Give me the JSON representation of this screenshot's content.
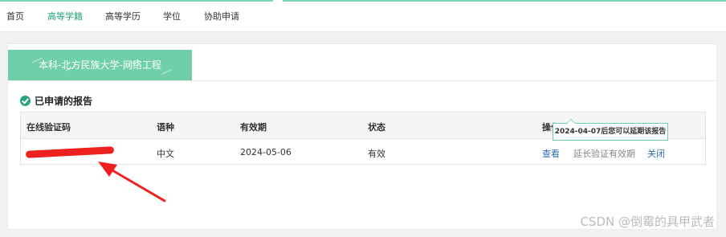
{
  "nav": {
    "items": [
      {
        "label": "首页",
        "active": false
      },
      {
        "label": "高等学籍",
        "active": true
      },
      {
        "label": "高等学历",
        "active": false
      },
      {
        "label": "学位",
        "active": false
      },
      {
        "label": "协助申请",
        "active": false
      }
    ]
  },
  "tab": {
    "label": "本科-北方民族大学-网络工程"
  },
  "section": {
    "title": "已申请的报告",
    "icon": "check-circle-icon"
  },
  "table": {
    "headers": [
      "在线验证码",
      "语种",
      "有效期",
      "状态",
      "操作"
    ],
    "rows": [
      {
        "code": "",
        "language": "中文",
        "expiry": "2024-05-06",
        "status": "有效",
        "actions": {
          "view": "查看",
          "extend": "延长验证有效期",
          "close": "关闭"
        }
      }
    ]
  },
  "tooltip": {
    "text": "2024-04-07后您可以延期该报告"
  },
  "watermark": {
    "text": "CSDN @倒霉的具甲武者"
  },
  "colors": {
    "accent": "#27a47a",
    "banner": "#6fcfa9",
    "link": "#2e6db4",
    "annotation": "#ef2020"
  }
}
